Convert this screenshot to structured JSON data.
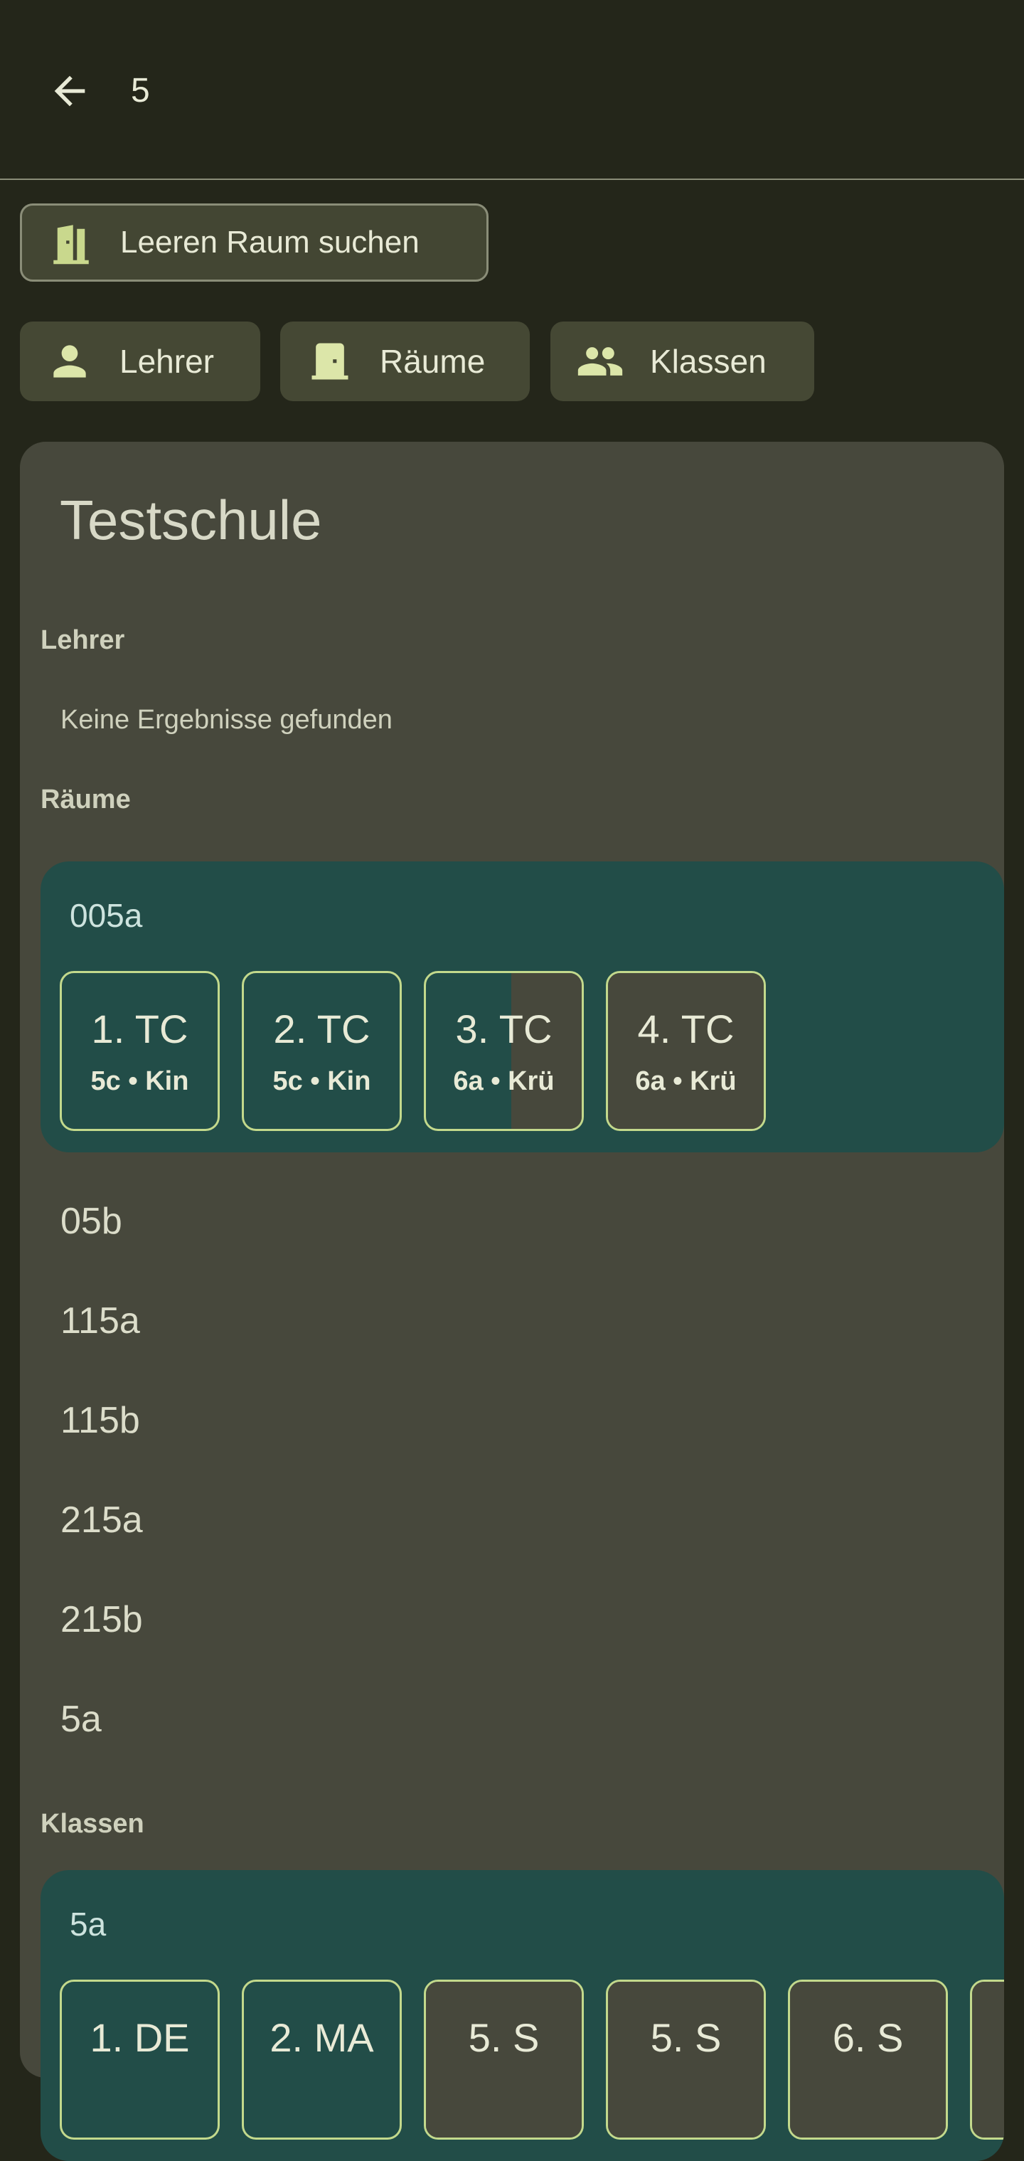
{
  "header": {
    "back_icon": "arrow-left-icon",
    "title": "5"
  },
  "empty_room_button": {
    "icon": "door-icon",
    "label": "Leeren Raum suchen"
  },
  "filters": [
    {
      "icon": "person-icon",
      "label": "Lehrer"
    },
    {
      "icon": "door-icon",
      "label": "Räume"
    },
    {
      "icon": "people-icon",
      "label": "Klassen"
    }
  ],
  "card": {
    "title": "Testschule",
    "teachers": {
      "label": "Lehrer",
      "empty_text": "Keine Ergebnisse gefunden"
    },
    "rooms": {
      "label": "Räume",
      "expanded": {
        "name": "005a",
        "lessons": [
          {
            "title": "1. TC",
            "subtitle": "5c • Kin",
            "elapsed_fraction": 1.0
          },
          {
            "title": "2. TC",
            "subtitle": "5c • Kin",
            "elapsed_fraction": 1.0
          },
          {
            "title": "3. TC",
            "subtitle": "6a • Krü",
            "elapsed_fraction": 0.55
          },
          {
            "title": "4. TC",
            "subtitle": "6a • Krü",
            "elapsed_fraction": 0.0
          }
        ]
      },
      "items": [
        "05b",
        "115a",
        "115b",
        "215a",
        "215b",
        "5a"
      ]
    },
    "classes": {
      "label": "Klassen",
      "expanded": {
        "name": "5a",
        "lessons": [
          {
            "title": "1. DE",
            "elapsed_fraction": 1.0
          },
          {
            "title": "2. MA",
            "elapsed_fraction": 1.0
          },
          {
            "title": "5. S",
            "elapsed_fraction": 0.0
          },
          {
            "title": "5. S",
            "elapsed_fraction": 0.0
          },
          {
            "title": "6. S",
            "elapsed_fraction": 0.0
          }
        ]
      }
    }
  },
  "colors": {
    "background": "#24261a",
    "surface": "#47483c",
    "chip": "#454834",
    "group": "#224d48",
    "tile_border": "#c3d98c",
    "icon": "#dce6a9"
  }
}
